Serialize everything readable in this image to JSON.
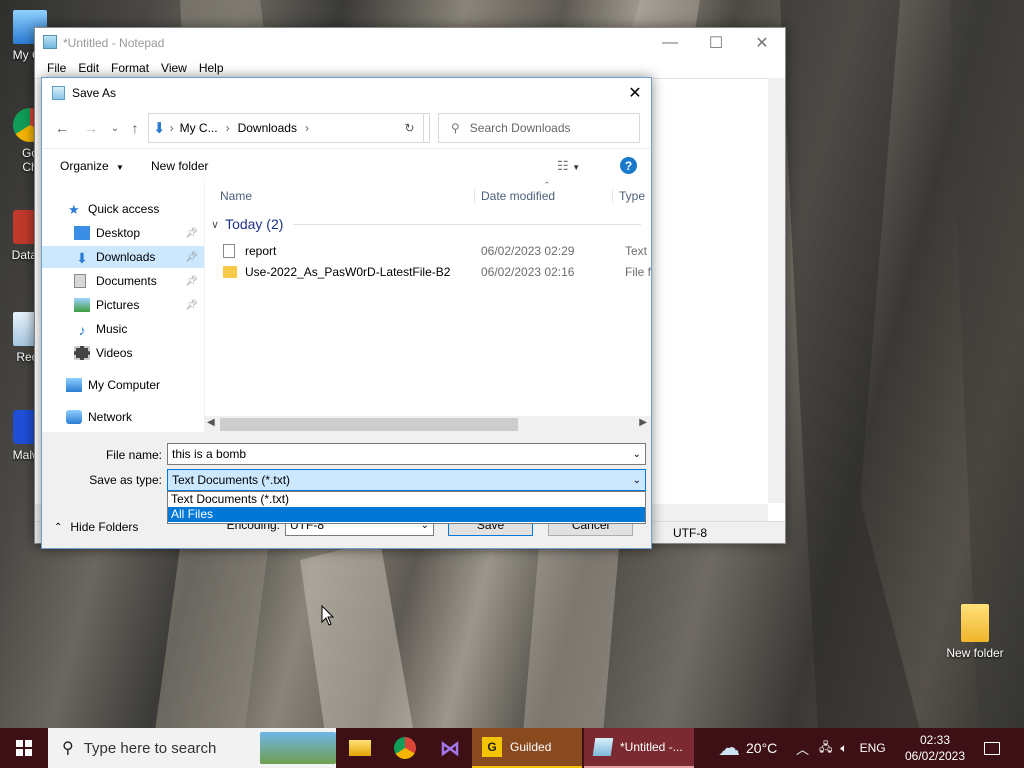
{
  "desktop": {
    "icons": [
      {
        "label": "My Co"
      },
      {
        "label": "Go\nCh"
      },
      {
        "label": "DataW"
      },
      {
        "label": "Recy"
      },
      {
        "label": "Malwa"
      },
      {
        "label": "New folder"
      }
    ]
  },
  "notepad": {
    "title": "*Untitled - Notepad",
    "menu": [
      "File",
      "Edit",
      "Format",
      "View",
      "Help"
    ],
    "status_encoding": "UTF-8"
  },
  "saveas": {
    "title": "Save As",
    "close": "✕",
    "address": {
      "crumbs": [
        "My C...",
        "Downloads"
      ]
    },
    "search_placeholder": "Search Downloads",
    "toolbar": {
      "organize": "Organize",
      "new_folder": "New folder",
      "help": "?"
    },
    "nav": {
      "quick_access": "Quick access",
      "items": [
        {
          "label": "Desktop",
          "pinned": true
        },
        {
          "label": "Downloads",
          "pinned": true
        },
        {
          "label": "Documents",
          "pinned": true
        },
        {
          "label": "Pictures",
          "pinned": true
        },
        {
          "label": "Music",
          "pinned": false
        },
        {
          "label": "Videos",
          "pinned": false
        }
      ],
      "my_computer": "My Computer",
      "network": "Network"
    },
    "columns": {
      "name": "Name",
      "date": "Date modified",
      "type": "Type"
    },
    "group": "Today (2)",
    "files": [
      {
        "name": "report",
        "date": "06/02/2023 02:29",
        "type": "Text D",
        "icon": "text-file-icon"
      },
      {
        "name": "Use-2022_As_PasW0rD-LatestFile-B2",
        "date": "06/02/2023 02:16",
        "type": "File fo",
        "icon": "folder-icon"
      }
    ],
    "file_name_label": "File name:",
    "file_name_value": "this is a bomb",
    "save_type_label": "Save as type:",
    "save_type_value": "Text Documents (*.txt)",
    "type_options": [
      "Text Documents (*.txt)",
      "All Files"
    ],
    "encoding_label": "Encoding:",
    "encoding_value": "UTF-8",
    "hide_folders": "Hide Folders",
    "save": "Save",
    "cancel": "Cancel"
  },
  "taskbar": {
    "search_placeholder": "Type here to search",
    "apps": [
      {
        "label": "Guilded"
      },
      {
        "label": "*Untitled -..."
      }
    ],
    "weather": "20°C",
    "lang": "ENG",
    "time": "02:33",
    "date": "06/02/2023"
  },
  "colors": {
    "accent": "#0078d7",
    "selection": "#cce8ff",
    "taskbar": "#3c1014",
    "guilded": "#f5c400"
  }
}
